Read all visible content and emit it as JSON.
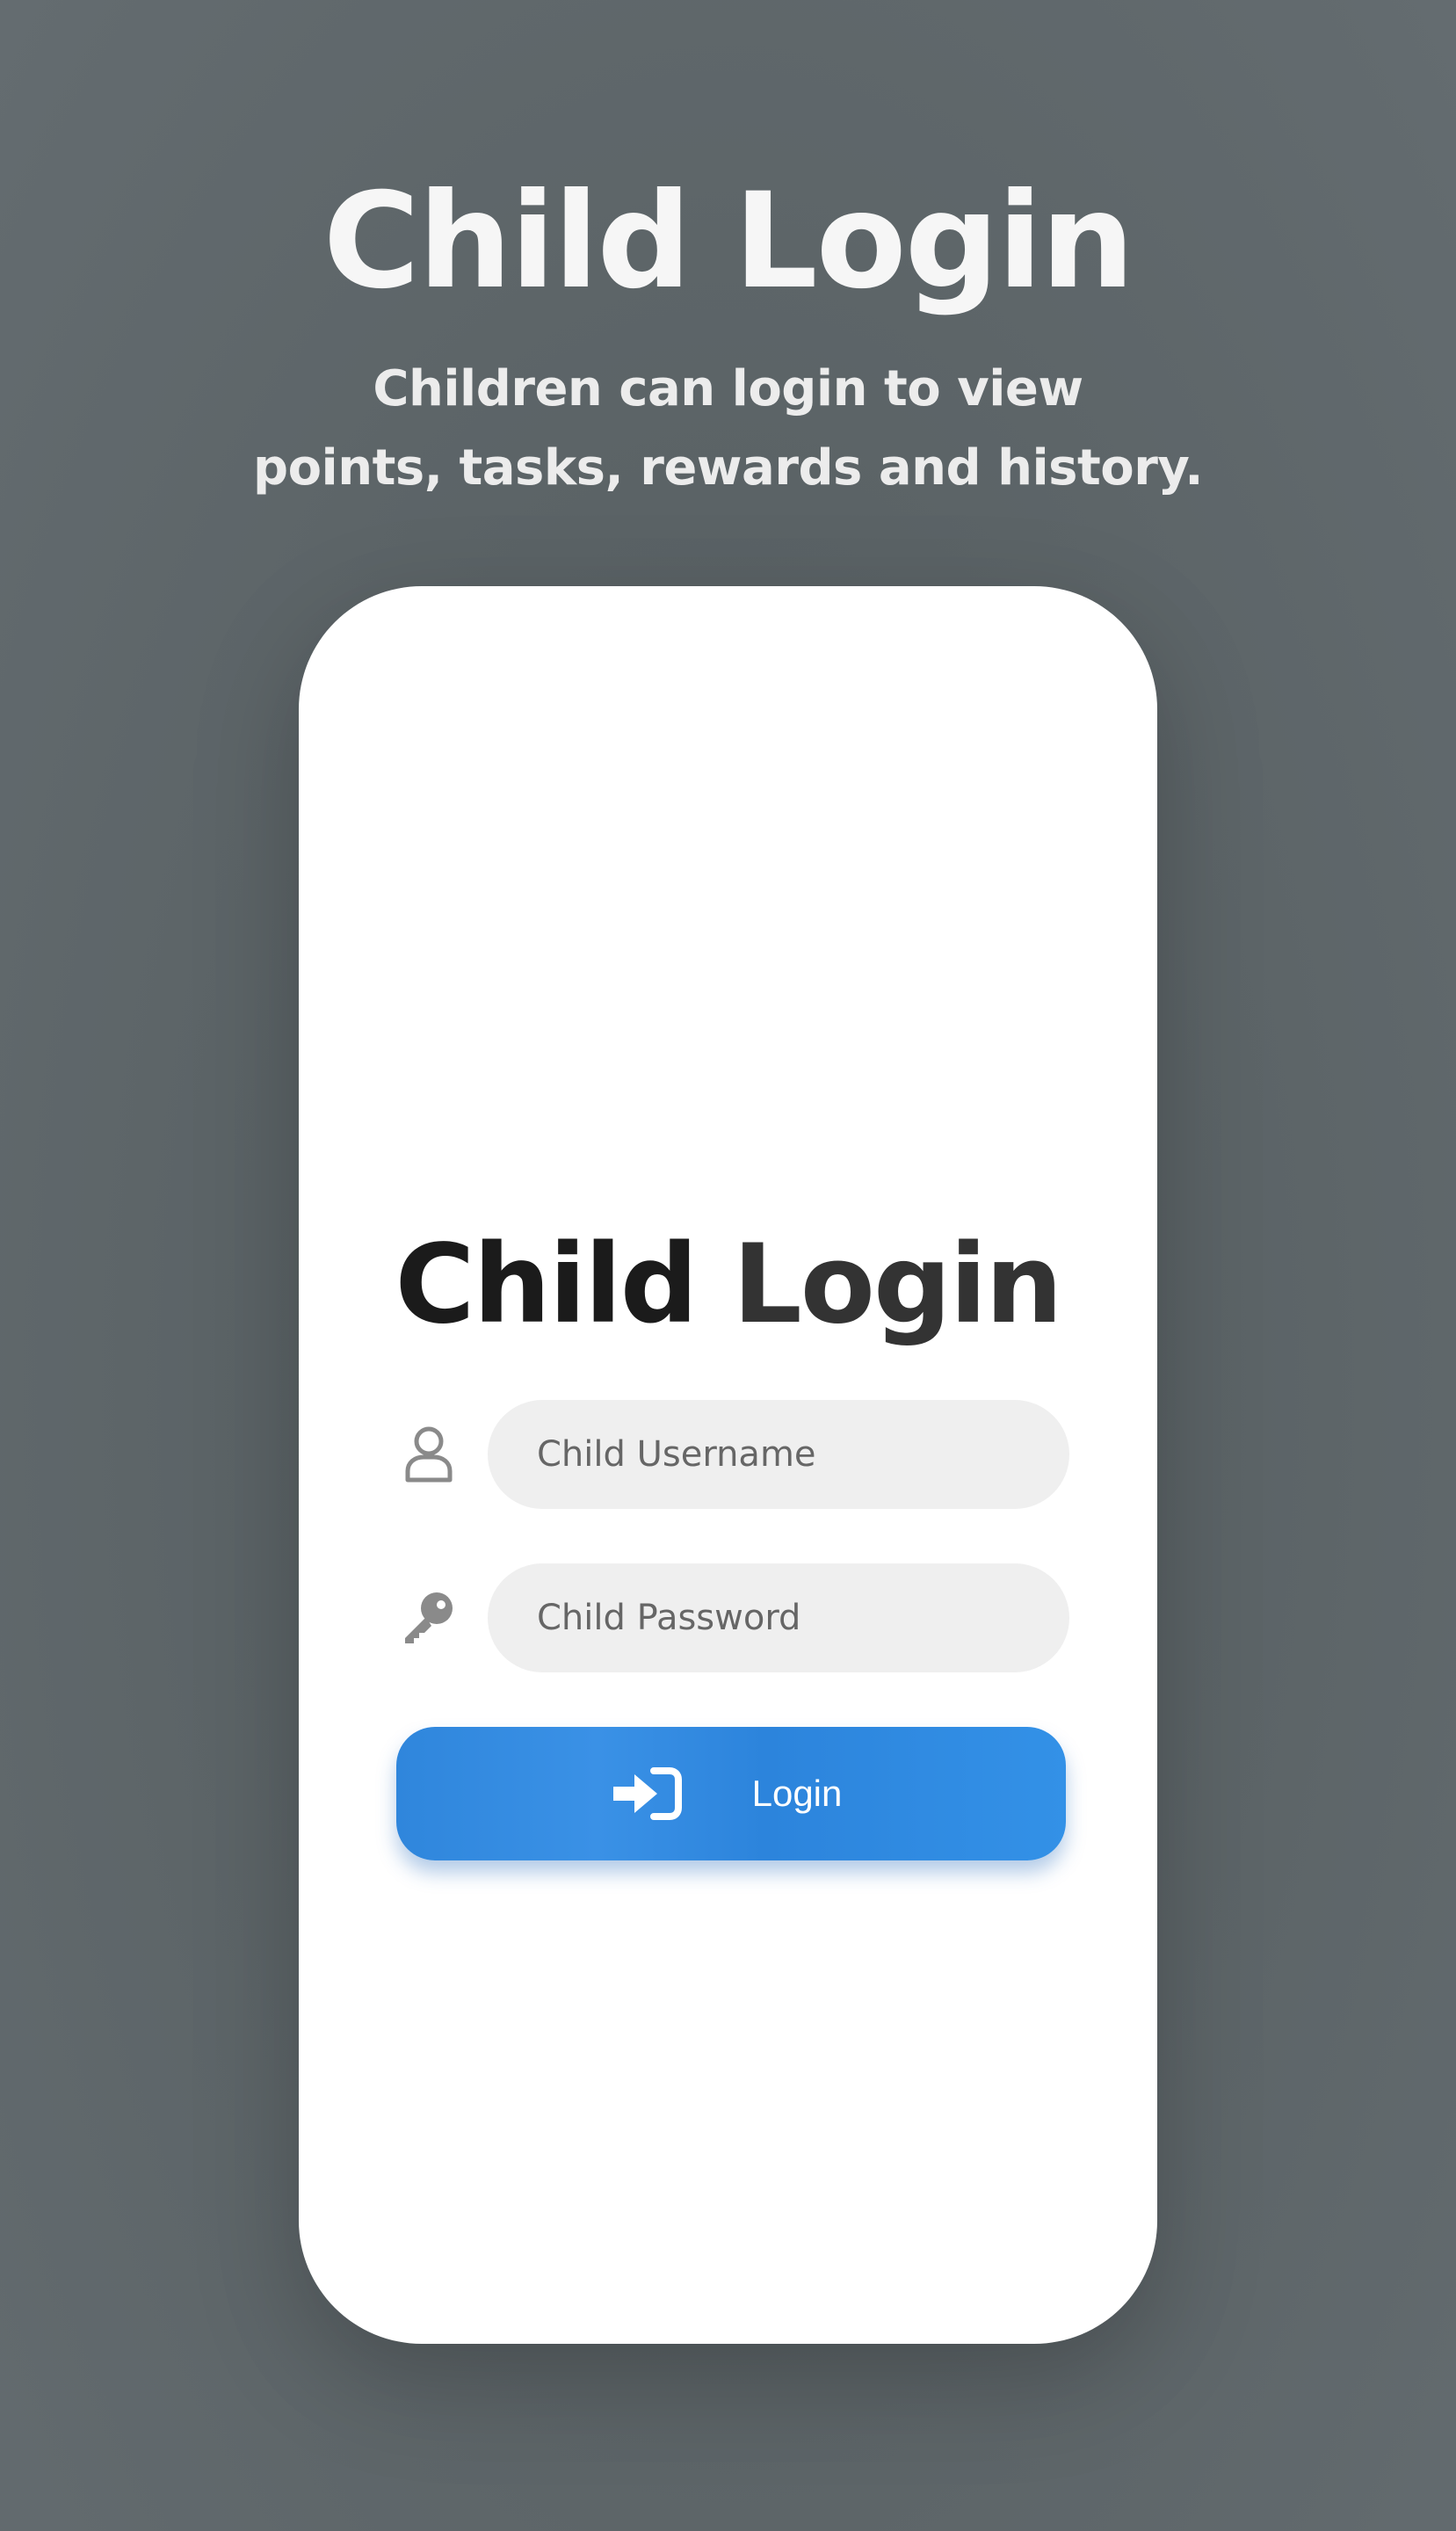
{
  "promo": {
    "title": "Child Login",
    "subtitle_line1": "Children can login to view",
    "subtitle_line2": "points, tasks, rewards and history."
  },
  "screen": {
    "title_word1": "Child",
    "title_word2": "Login",
    "username": {
      "icon": "user-icon",
      "placeholder": "Child Username",
      "value": ""
    },
    "password": {
      "icon": "key-icon",
      "placeholder": "Child Password",
      "value": ""
    },
    "login_button": {
      "icon": "sign-in-icon",
      "label": "Login"
    }
  },
  "colors": {
    "background": "#5c6467",
    "card": "#ffffff",
    "input_bg": "#efefef",
    "button_accent": "#2f86dc",
    "title_text": "#1b1b1b"
  }
}
